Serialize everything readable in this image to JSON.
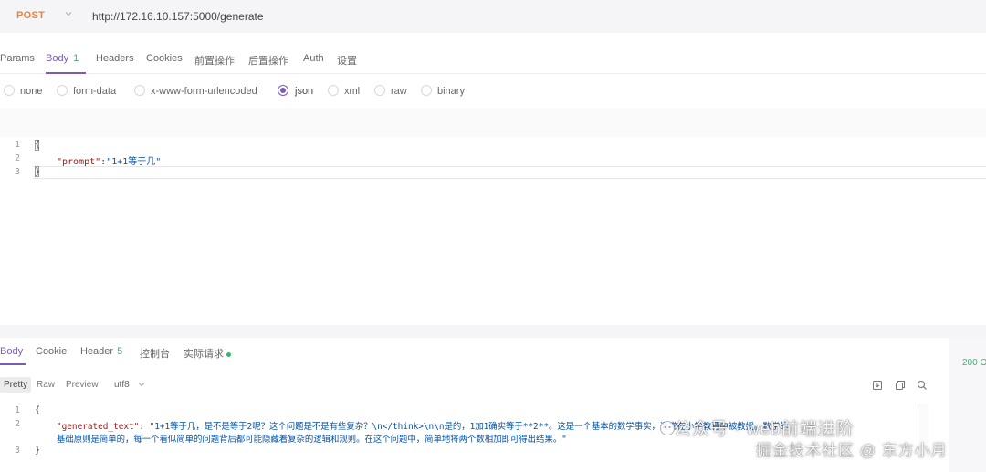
{
  "request": {
    "method": "POST",
    "url": "http://172.16.10.157:5000/generate"
  },
  "request_tabs": [
    {
      "label": "Params",
      "count": ""
    },
    {
      "label": "Body",
      "count": "1"
    },
    {
      "label": "Headers",
      "count": ""
    },
    {
      "label": "Cookies",
      "count": ""
    },
    {
      "label": "前置操作",
      "count": ""
    },
    {
      "label": "后置操作",
      "count": ""
    },
    {
      "label": "Auth",
      "count": ""
    },
    {
      "label": "设置",
      "count": ""
    }
  ],
  "body_types": {
    "options": [
      "none",
      "form-data",
      "x-www-form-urlencoded",
      "json",
      "xml",
      "raw",
      "binary"
    ],
    "selected": "json"
  },
  "request_body": {
    "line_numbers": [
      "1",
      "2",
      "3"
    ],
    "line1": "{",
    "key": "\"prompt\"",
    "colon": ":",
    "value": "\"1+1等于几\"",
    "line3": "}"
  },
  "response_tabs": [
    {
      "label": "Body",
      "count": ""
    },
    {
      "label": "Cookie",
      "count": ""
    },
    {
      "label": "Header",
      "count": "5"
    },
    {
      "label": "控制台",
      "count": ""
    },
    {
      "label": "实际请求",
      "count": ""
    }
  ],
  "response_views": [
    "Pretty",
    "Raw",
    "Preview"
  ],
  "selected_view": "Pretty",
  "encoding": "utf8",
  "status": "200 O",
  "response_body": {
    "line_numbers": [
      "1",
      "2",
      "3"
    ],
    "line1": "{",
    "key": "\"generated_text\"",
    "colon": ": ",
    "value_part1": "\"1+1等于几，是不是等于2呢？这个问题是不是有些复杂？\\n</think>\\n\\n是的，1加1确实等于**2**。这是一个基本的数学事实，通常在小学教育中被教授。数学的",
    "value_part2": "基础原则是简单的，每一个看似简单的问题背后都可能隐藏着复杂的逻辑和规则。在这个问题中，简单地将两个数相加即可得出结果。\"",
    "line3": "}"
  },
  "watermark": {
    "line1": "公众号 · web前端进阶",
    "line2": "掘金技术社区 @ 东方小月"
  },
  "colors": {
    "accent": "#7a5bb8",
    "method": "#f0803c",
    "success": "#3cb371"
  }
}
